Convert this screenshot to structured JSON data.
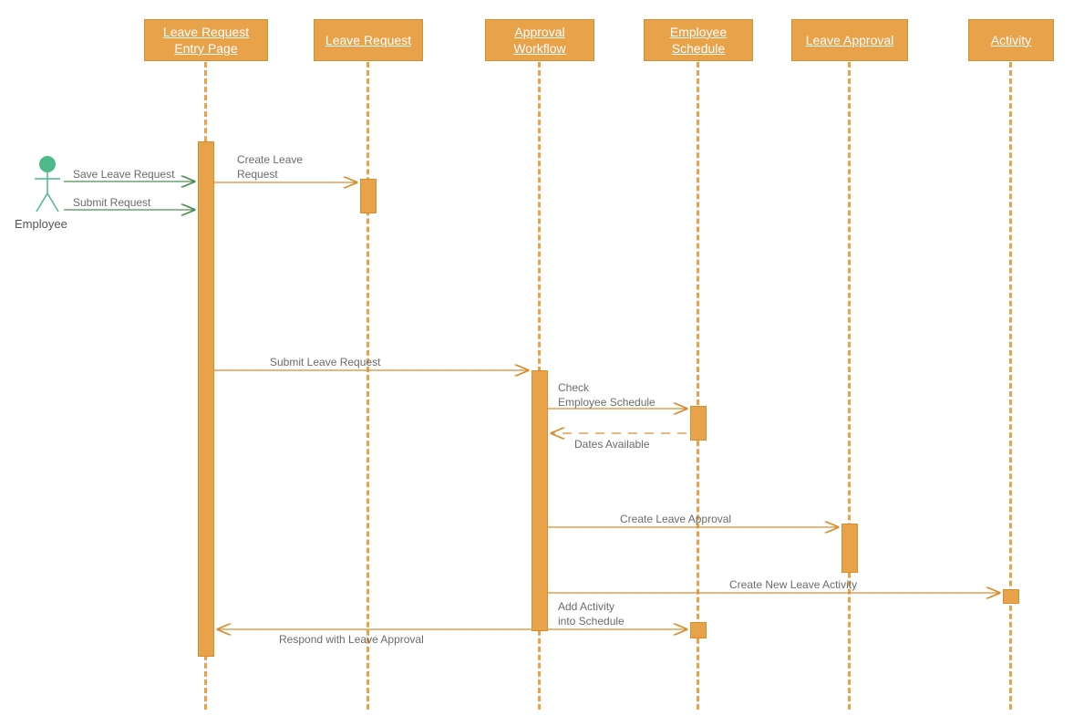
{
  "actor": {
    "label": "Employee"
  },
  "lifelines": {
    "l0": "Leave Request Entry Page",
    "l1": "Leave Request",
    "l2": "Approval Workflow",
    "l3": "Employee Schedule",
    "l4": "Leave Approval",
    "l5": "Activity"
  },
  "messages": {
    "m0": "Save Leave Request",
    "m1": "Submit  Request",
    "m2": "Create Leave\nRequest",
    "m3": "Submit  Leave Request",
    "m4": "Check\nEmployee Schedule",
    "m5": "Dates Available",
    "m6": "Create Leave Approval",
    "m7": "Create New Leave Activity",
    "m8": "Add Activity\ninto Schedule",
    "m9": "Respond with Leave Approval"
  },
  "colors": {
    "primary": "#e8a24a",
    "actor": "#4eb98a",
    "text": "#6b6b6b"
  }
}
